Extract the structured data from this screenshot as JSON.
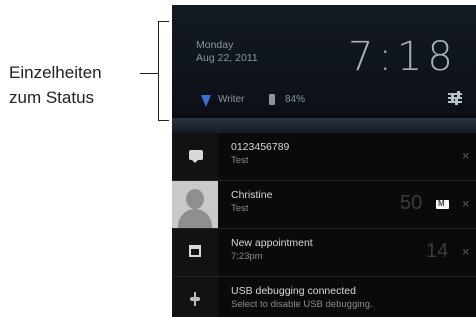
{
  "annotation": {
    "line1": "Einzelheiten",
    "line2": "zum Status"
  },
  "status_panel": {
    "day": "Monday",
    "date": "Aug 22, 2011",
    "time": "7:18",
    "network": "Writer",
    "battery": "84%"
  },
  "notifications": [
    {
      "title": "0123456789",
      "subtitle": "Test",
      "close": "×"
    },
    {
      "title": "Christine",
      "subtitle": "Test",
      "count": "50",
      "close": "×"
    },
    {
      "title": "New appointment",
      "subtitle": "7:23pm",
      "count": "14",
      "close": "×"
    },
    {
      "title": "USB debugging connected",
      "subtitle": "Select to disable USB debugging."
    }
  ],
  "colors": {
    "wifi": "#3e6fd0",
    "background": "#0b0b0b"
  }
}
